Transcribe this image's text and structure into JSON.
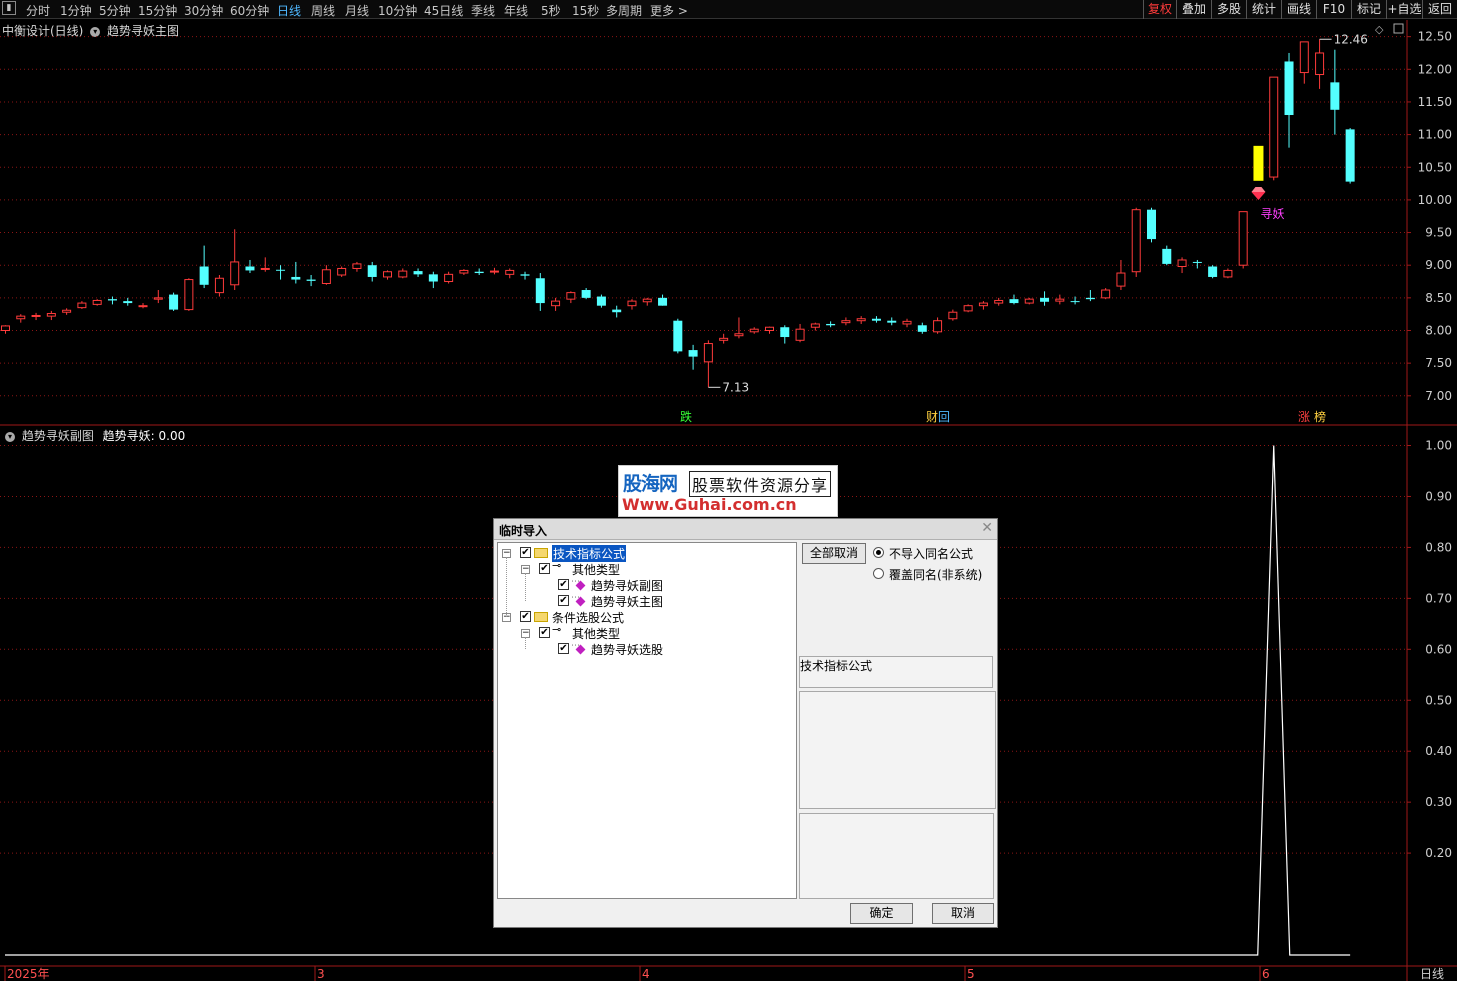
{
  "toolbar": {
    "periods": [
      "分时",
      "1分钟",
      "5分钟",
      "15分钟",
      "30分钟",
      "60分钟",
      "日线",
      "周线",
      "月线",
      "10分钟",
      "45日线",
      "季线",
      "年线",
      "5秒",
      "15秒",
      "多周期",
      "更多 >"
    ],
    "active_period": "日线",
    "right_buttons": [
      "复权",
      "叠加",
      "多股",
      "统计",
      "画线",
      "F10",
      "标记",
      "+自选",
      "返回"
    ]
  },
  "main_chart": {
    "title": "中衡设计(日线)",
    "formula": "趋势寻妖主图",
    "y_ticks": [
      "12.50",
      "12.00",
      "11.50",
      "11.00",
      "10.50",
      "10.00",
      "9.50",
      "9.00",
      "8.50",
      "8.00",
      "7.50",
      "7.00"
    ],
    "high_label": "12.46",
    "low_label": "7.13",
    "signal_label": "寻妖",
    "markers": [
      "跌",
      "财",
      "回",
      "涨",
      "榜"
    ]
  },
  "sub_chart": {
    "title": "趋势寻妖副图",
    "indicator": "趋势寻妖: 0.00",
    "y_ticks": [
      "1.00",
      "0.90",
      "0.80",
      "0.70",
      "0.60",
      "0.50",
      "0.40",
      "0.30",
      "0.20"
    ]
  },
  "x_axis": {
    "labels": [
      "2025年",
      "3",
      "4",
      "5",
      "6"
    ],
    "period_label": "日线"
  },
  "watermark": {
    "line1": "股海网",
    "line2": "股票软件资源分享",
    "line3": "Www.Guhai.com.cn"
  },
  "dialog": {
    "title": "临时导入",
    "close": "✕",
    "tree": [
      {
        "label": "技术指标公式",
        "level": 0,
        "selected": true
      },
      {
        "label": "其他类型",
        "level": 1
      },
      {
        "label": "趋势寻妖副图",
        "level": 2
      },
      {
        "label": "趋势寻妖主图",
        "level": 2
      },
      {
        "label": "条件选股公式",
        "level": 0
      },
      {
        "label": "其他类型",
        "level": 1
      },
      {
        "label": "趋势寻妖选股",
        "level": 2
      }
    ],
    "cancel_all": "全部取消",
    "radio_options": [
      "不导入同名公式",
      "覆盖同名(非系统)"
    ],
    "info_label": "技术指标公式",
    "ok": "确定",
    "cancel": "取消"
  },
  "colors": {
    "up": "#ff3b3b",
    "down": "#54ffff",
    "grid": "#8b1515",
    "highlight": "#ffff00",
    "signal": "#ff40ff"
  },
  "chart_data": {
    "type": "candlestick",
    "series_main": {
      "dates_range": [
        "2025-02",
        "2025-06"
      ],
      "ohlc": [
        [
          8.0,
          8.08,
          7.95,
          8.07
        ],
        [
          8.18,
          8.25,
          8.12,
          8.22
        ],
        [
          8.22,
          8.27,
          8.16,
          8.23
        ],
        [
          8.22,
          8.3,
          8.16,
          8.26
        ],
        [
          8.28,
          8.34,
          8.24,
          8.31
        ],
        [
          8.35,
          8.45,
          8.33,
          8.42
        ],
        [
          8.4,
          8.48,
          8.38,
          8.46
        ],
        [
          8.48,
          8.52,
          8.4,
          8.46
        ],
        [
          8.45,
          8.5,
          8.38,
          8.42
        ],
        [
          8.38,
          8.42,
          8.34,
          8.38
        ],
        [
          8.48,
          8.62,
          8.42,
          8.5
        ],
        [
          8.55,
          8.58,
          8.3,
          8.32
        ],
        [
          8.32,
          8.8,
          8.3,
          8.78
        ],
        [
          8.98,
          9.3,
          8.65,
          8.7
        ],
        [
          8.58,
          8.85,
          8.52,
          8.8
        ],
        [
          8.7,
          9.55,
          8.62,
          9.05
        ],
        [
          8.98,
          9.08,
          8.88,
          8.92
        ],
        [
          8.95,
          9.12,
          8.9,
          8.95
        ],
        [
          8.93,
          9.0,
          8.78,
          8.92
        ],
        [
          8.82,
          9.05,
          8.72,
          8.78
        ],
        [
          8.78,
          8.85,
          8.68,
          8.76
        ],
        [
          8.72,
          9.0,
          8.7,
          8.93
        ],
        [
          8.85,
          8.98,
          8.82,
          8.95
        ],
        [
          8.95,
          9.05,
          8.9,
          9.02
        ],
        [
          9.0,
          9.05,
          8.75,
          8.82
        ],
        [
          8.82,
          8.92,
          8.78,
          8.9
        ],
        [
          8.82,
          8.95,
          8.8,
          8.91
        ],
        [
          8.91,
          8.95,
          8.82,
          8.86
        ],
        [
          8.86,
          8.9,
          8.65,
          8.75
        ],
        [
          8.75,
          8.9,
          8.72,
          8.86
        ],
        [
          8.88,
          8.94,
          8.85,
          8.92
        ],
        [
          8.9,
          8.95,
          8.85,
          8.88
        ],
        [
          8.9,
          8.96,
          8.86,
          8.91
        ],
        [
          8.86,
          8.95,
          8.8,
          8.92
        ],
        [
          8.86,
          8.9,
          8.78,
          8.84
        ],
        [
          8.8,
          8.88,
          8.3,
          8.42
        ],
        [
          8.38,
          8.5,
          8.3,
          8.45
        ],
        [
          8.48,
          8.6,
          8.42,
          8.58
        ],
        [
          8.62,
          8.65,
          8.48,
          8.5
        ],
        [
          8.52,
          8.55,
          8.35,
          8.38
        ],
        [
          8.32,
          8.38,
          8.2,
          8.28
        ],
        [
          8.38,
          8.48,
          8.32,
          8.45
        ],
        [
          8.44,
          8.5,
          8.38,
          8.48
        ],
        [
          8.5,
          8.55,
          8.38,
          8.38
        ],
        [
          8.15,
          8.18,
          7.65,
          7.68
        ],
        [
          7.7,
          7.78,
          7.4,
          7.6
        ],
        [
          7.52,
          7.85,
          7.13,
          7.8
        ],
        [
          7.85,
          7.95,
          7.8,
          7.88
        ],
        [
          7.92,
          8.2,
          7.88,
          7.95
        ],
        [
          7.98,
          8.05,
          7.95,
          8.02
        ],
        [
          8.0,
          8.06,
          7.95,
          8.05
        ],
        [
          8.05,
          8.08,
          7.8,
          7.9
        ],
        [
          7.85,
          8.1,
          7.82,
          8.02
        ],
        [
          8.05,
          8.12,
          8.0,
          8.1
        ],
        [
          8.1,
          8.14,
          8.05,
          8.08
        ],
        [
          8.12,
          8.2,
          8.08,
          8.15
        ],
        [
          8.15,
          8.22,
          8.1,
          8.18
        ],
        [
          8.18,
          8.22,
          8.12,
          8.15
        ],
        [
          8.15,
          8.2,
          8.08,
          8.12
        ],
        [
          8.1,
          8.18,
          8.05,
          8.14
        ],
        [
          8.08,
          8.12,
          7.95,
          7.98
        ],
        [
          7.98,
          8.2,
          7.95,
          8.15
        ],
        [
          8.18,
          8.32,
          8.15,
          8.28
        ],
        [
          8.3,
          8.4,
          8.28,
          8.38
        ],
        [
          8.38,
          8.45,
          8.32,
          8.42
        ],
        [
          8.42,
          8.5,
          8.38,
          8.46
        ],
        [
          8.48,
          8.55,
          8.4,
          8.42
        ],
        [
          8.42,
          8.5,
          8.4,
          8.48
        ],
        [
          8.5,
          8.6,
          8.38,
          8.44
        ],
        [
          8.45,
          8.55,
          8.4,
          8.48
        ],
        [
          8.45,
          8.52,
          8.4,
          8.44
        ],
        [
          8.5,
          8.62,
          8.45,
          8.48
        ],
        [
          8.5,
          8.65,
          8.48,
          8.62
        ],
        [
          8.68,
          9.08,
          8.62,
          8.88
        ],
        [
          8.9,
          9.88,
          8.82,
          9.85
        ],
        [
          9.85,
          9.88,
          9.35,
          9.4
        ],
        [
          9.25,
          9.3,
          9.0,
          9.02
        ],
        [
          8.98,
          9.12,
          8.88,
          9.08
        ],
        [
          9.05,
          9.08,
          8.95,
          9.04
        ],
        [
          8.98,
          9.0,
          8.8,
          8.82
        ],
        [
          8.82,
          8.95,
          8.8,
          8.92
        ],
        [
          9.0,
          9.82,
          8.95,
          9.82
        ],
        [
          10.82,
          10.82,
          10.3,
          10.3
        ],
        [
          10.35,
          11.88,
          10.3,
          11.88
        ],
        [
          12.12,
          12.25,
          10.8,
          11.3
        ],
        [
          11.95,
          12.42,
          11.78,
          12.42
        ],
        [
          11.92,
          12.46,
          11.7,
          12.25
        ],
        [
          11.8,
          12.3,
          11.0,
          11.38
        ],
        [
          11.08,
          11.1,
          10.25,
          10.28
        ]
      ],
      "high": 12.46,
      "low": 7.13
    },
    "series_sub": {
      "name": "趋势寻妖",
      "current": 0.0,
      "peak": 1.0,
      "peak_bar": 83
    }
  }
}
